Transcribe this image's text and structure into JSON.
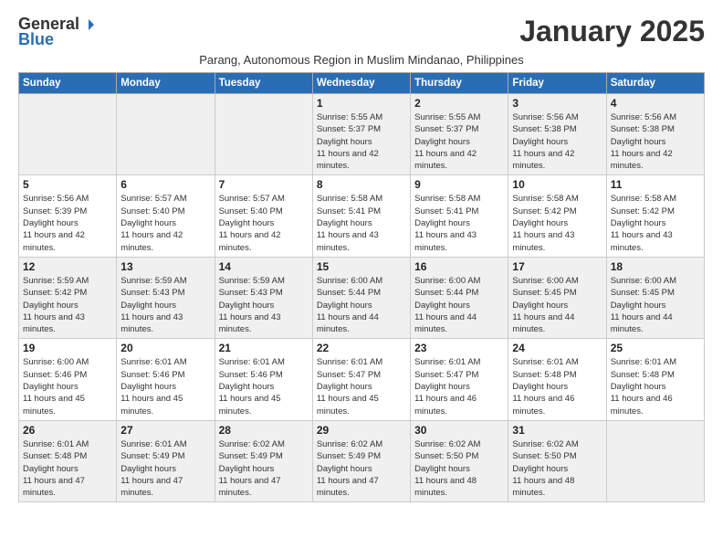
{
  "logo": {
    "general": "General",
    "blue": "Blue"
  },
  "title": "January 2025",
  "subtitle": "Parang, Autonomous Region in Muslim Mindanao, Philippines",
  "days_header": [
    "Sunday",
    "Monday",
    "Tuesday",
    "Wednesday",
    "Thursday",
    "Friday",
    "Saturday"
  ],
  "weeks": [
    [
      {
        "day": "",
        "empty": true
      },
      {
        "day": "",
        "empty": true
      },
      {
        "day": "",
        "empty": true
      },
      {
        "day": "1",
        "sunrise": "5:55 AM",
        "sunset": "5:37 PM",
        "daylight": "11 hours and 42 minutes."
      },
      {
        "day": "2",
        "sunrise": "5:55 AM",
        "sunset": "5:37 PM",
        "daylight": "11 hours and 42 minutes."
      },
      {
        "day": "3",
        "sunrise": "5:56 AM",
        "sunset": "5:38 PM",
        "daylight": "11 hours and 42 minutes."
      },
      {
        "day": "4",
        "sunrise": "5:56 AM",
        "sunset": "5:38 PM",
        "daylight": "11 hours and 42 minutes."
      }
    ],
    [
      {
        "day": "5",
        "sunrise": "5:56 AM",
        "sunset": "5:39 PM",
        "daylight": "11 hours and 42 minutes."
      },
      {
        "day": "6",
        "sunrise": "5:57 AM",
        "sunset": "5:40 PM",
        "daylight": "11 hours and 42 minutes."
      },
      {
        "day": "7",
        "sunrise": "5:57 AM",
        "sunset": "5:40 PM",
        "daylight": "11 hours and 42 minutes."
      },
      {
        "day": "8",
        "sunrise": "5:58 AM",
        "sunset": "5:41 PM",
        "daylight": "11 hours and 43 minutes."
      },
      {
        "day": "9",
        "sunrise": "5:58 AM",
        "sunset": "5:41 PM",
        "daylight": "11 hours and 43 minutes."
      },
      {
        "day": "10",
        "sunrise": "5:58 AM",
        "sunset": "5:42 PM",
        "daylight": "11 hours and 43 minutes."
      },
      {
        "day": "11",
        "sunrise": "5:58 AM",
        "sunset": "5:42 PM",
        "daylight": "11 hours and 43 minutes."
      }
    ],
    [
      {
        "day": "12",
        "sunrise": "5:59 AM",
        "sunset": "5:42 PM",
        "daylight": "11 hours and 43 minutes."
      },
      {
        "day": "13",
        "sunrise": "5:59 AM",
        "sunset": "5:43 PM",
        "daylight": "11 hours and 43 minutes."
      },
      {
        "day": "14",
        "sunrise": "5:59 AM",
        "sunset": "5:43 PM",
        "daylight": "11 hours and 43 minutes."
      },
      {
        "day": "15",
        "sunrise": "6:00 AM",
        "sunset": "5:44 PM",
        "daylight": "11 hours and 44 minutes."
      },
      {
        "day": "16",
        "sunrise": "6:00 AM",
        "sunset": "5:44 PM",
        "daylight": "11 hours and 44 minutes."
      },
      {
        "day": "17",
        "sunrise": "6:00 AM",
        "sunset": "5:45 PM",
        "daylight": "11 hours and 44 minutes."
      },
      {
        "day": "18",
        "sunrise": "6:00 AM",
        "sunset": "5:45 PM",
        "daylight": "11 hours and 44 minutes."
      }
    ],
    [
      {
        "day": "19",
        "sunrise": "6:00 AM",
        "sunset": "5:46 PM",
        "daylight": "11 hours and 45 minutes."
      },
      {
        "day": "20",
        "sunrise": "6:01 AM",
        "sunset": "5:46 PM",
        "daylight": "11 hours and 45 minutes."
      },
      {
        "day": "21",
        "sunrise": "6:01 AM",
        "sunset": "5:46 PM",
        "daylight": "11 hours and 45 minutes."
      },
      {
        "day": "22",
        "sunrise": "6:01 AM",
        "sunset": "5:47 PM",
        "daylight": "11 hours and 45 minutes."
      },
      {
        "day": "23",
        "sunrise": "6:01 AM",
        "sunset": "5:47 PM",
        "daylight": "11 hours and 46 minutes."
      },
      {
        "day": "24",
        "sunrise": "6:01 AM",
        "sunset": "5:48 PM",
        "daylight": "11 hours and 46 minutes."
      },
      {
        "day": "25",
        "sunrise": "6:01 AM",
        "sunset": "5:48 PM",
        "daylight": "11 hours and 46 minutes."
      }
    ],
    [
      {
        "day": "26",
        "sunrise": "6:01 AM",
        "sunset": "5:48 PM",
        "daylight": "11 hours and 47 minutes."
      },
      {
        "day": "27",
        "sunrise": "6:01 AM",
        "sunset": "5:49 PM",
        "daylight": "11 hours and 47 minutes."
      },
      {
        "day": "28",
        "sunrise": "6:02 AM",
        "sunset": "5:49 PM",
        "daylight": "11 hours and 47 minutes."
      },
      {
        "day": "29",
        "sunrise": "6:02 AM",
        "sunset": "5:49 PM",
        "daylight": "11 hours and 47 minutes."
      },
      {
        "day": "30",
        "sunrise": "6:02 AM",
        "sunset": "5:50 PM",
        "daylight": "11 hours and 48 minutes."
      },
      {
        "day": "31",
        "sunrise": "6:02 AM",
        "sunset": "5:50 PM",
        "daylight": "11 hours and 48 minutes."
      },
      {
        "day": "",
        "empty": true
      }
    ]
  ]
}
